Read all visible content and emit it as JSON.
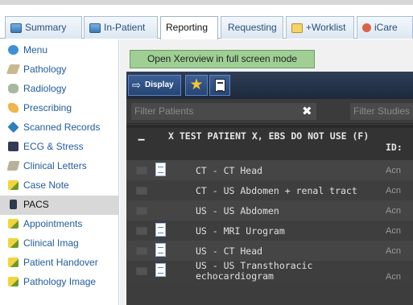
{
  "tabs": [
    {
      "label": "Summary",
      "icon": "summary-icon"
    },
    {
      "label": "In-Patient",
      "icon": "summary-icon"
    },
    {
      "label": "Reporting"
    },
    {
      "label": "Requesting"
    },
    {
      "label": "+Worklist",
      "icon": "worklist-icon"
    },
    {
      "label": "iCare",
      "icon": "icare-icon"
    }
  ],
  "active_tab": "Reporting",
  "sidebar": {
    "items": [
      {
        "label": "Menu"
      },
      {
        "label": "Pathology"
      },
      {
        "label": "Radiology"
      },
      {
        "label": "Prescribing"
      },
      {
        "label": "Scanned Records"
      },
      {
        "label": "ECG & Stress"
      },
      {
        "label": "Clinical Letters"
      },
      {
        "label": "Case Note"
      },
      {
        "label": "PACS"
      },
      {
        "label": "Appointments"
      },
      {
        "label": "Clinical Imag"
      },
      {
        "label": "Patient Handover"
      },
      {
        "label": "Pathology Image"
      }
    ],
    "active": "PACS"
  },
  "main": {
    "xeroview_button": "Open Xeroview in full screen mode",
    "toolbar": {
      "display_label": "Display"
    },
    "filter": {
      "patients_placeholder": "Filter Patients",
      "clear_symbol": "✖",
      "studies_placeholder": "Filter Studies"
    },
    "patient": {
      "collapse_symbol": "−",
      "name": "X TEST PATIENT X, EBS DO NOT USE (F)",
      "id_label": "ID:"
    },
    "studies": [
      {
        "label": "CT - CT Head",
        "has_doc": true,
        "acc": "Acn"
      },
      {
        "label": "CT - US Abdomen + renal tract",
        "has_doc": false,
        "acc": "Acn"
      },
      {
        "label": "US - US Abdomen",
        "has_doc": false,
        "acc": "Acn"
      },
      {
        "label": "US - MRI Urogram",
        "has_doc": true,
        "acc": "Acn"
      },
      {
        "label": "US - CT Head",
        "has_doc": true,
        "acc": "Acn"
      },
      {
        "label": "US - US Transthoracic echocardiogram",
        "has_doc": true,
        "acc": "Acn"
      }
    ]
  },
  "colors": {
    "tab_text": "#2a4f7a",
    "sidebar_link": "#1f5b9c",
    "xeroview_green": "#9fcf94",
    "viewer_dark": "#3d3d3d",
    "toolbar_blue": "#264574",
    "star": "#f7c531"
  }
}
